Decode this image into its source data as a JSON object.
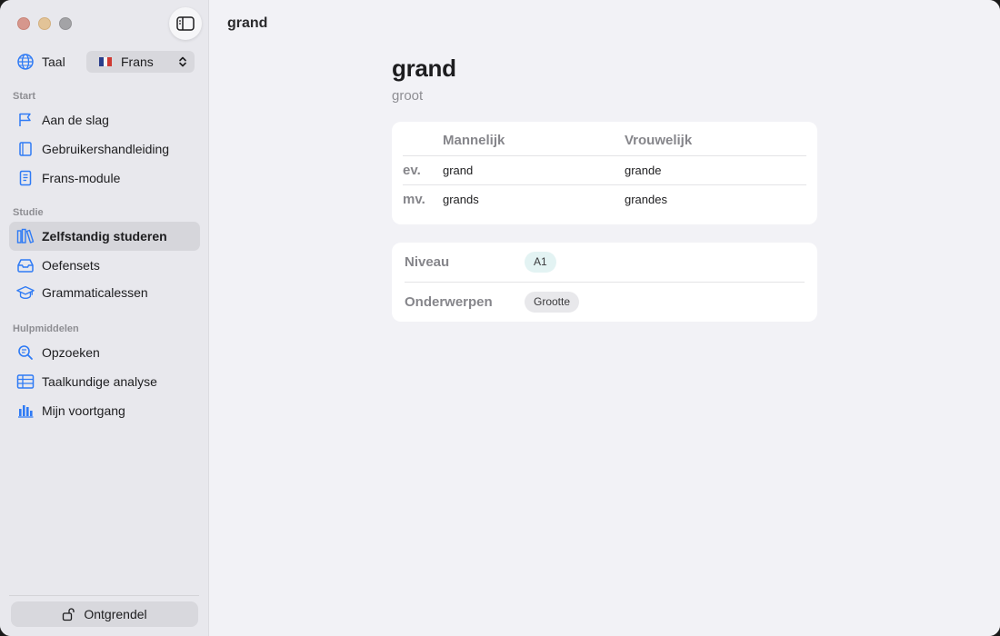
{
  "window": {
    "title": "grand"
  },
  "sidebar": {
    "language": {
      "label": "Taal",
      "value": "Frans",
      "flag": "french-flag"
    },
    "sections": [
      {
        "title": "Start",
        "items": [
          {
            "label": "Aan de slag",
            "icon": "flag-icon"
          },
          {
            "label": "Gebruikershandleiding",
            "icon": "book-icon"
          },
          {
            "label": "Frans-module",
            "icon": "document-icon"
          }
        ]
      },
      {
        "title": "Studie",
        "items": [
          {
            "label": "Zelfstandig studeren",
            "icon": "books-icon",
            "selected": true
          },
          {
            "label": "Oefensets",
            "icon": "tray-icon"
          },
          {
            "label": "Grammaticalessen",
            "icon": "graduation-cap-icon"
          }
        ]
      },
      {
        "title": "Hulpmiddelen",
        "items": [
          {
            "label": "Opzoeken",
            "icon": "magnifier-icon"
          },
          {
            "label": "Taalkundige analyse",
            "icon": "table-icon"
          },
          {
            "label": "Mijn voortgang",
            "icon": "bar-chart-icon"
          }
        ]
      }
    ],
    "unlock_label": "Ontgrendel"
  },
  "main": {
    "word": "grand",
    "translation": "groot",
    "forms": {
      "headers": [
        "Mannelijk",
        "Vrouwelijk"
      ],
      "rows": [
        {
          "label": "ev.",
          "masculine": "grand",
          "feminine": "grande"
        },
        {
          "label": "mv.",
          "masculine": "grands",
          "feminine": "grandes"
        }
      ]
    },
    "meta": {
      "level_label": "Niveau",
      "level_value": "A1",
      "topics_label": "Onderwerpen",
      "topics_value": "Grootte"
    }
  },
  "colors": {
    "accent": "#2f7bf5",
    "sidebar_bg": "#e8e8ed",
    "selected_bg": "#d6d6db",
    "level_chip_bg": "#e3f3f3",
    "topic_chip_bg": "#e8e8eb"
  }
}
